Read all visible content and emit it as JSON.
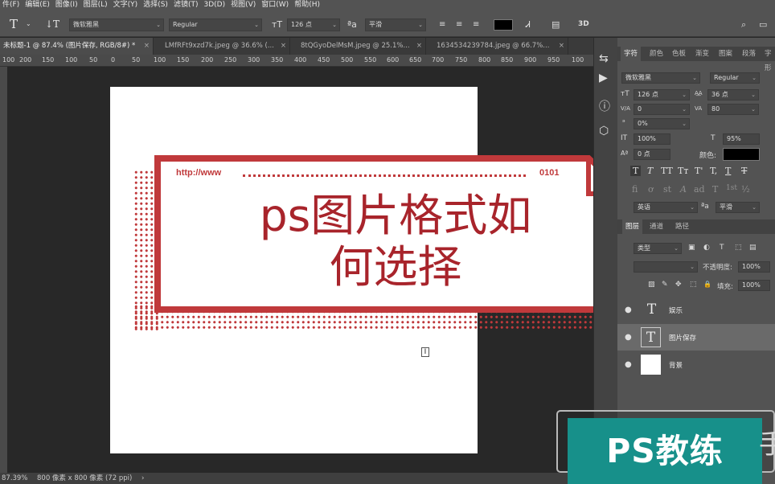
{
  "menu": [
    "件(F)",
    "编辑(E)",
    "图像(I)",
    "图层(L)",
    "文字(Y)",
    "选择(S)",
    "滤镜(T)",
    "3D(D)",
    "视图(V)",
    "窗口(W)",
    "帮助(H)"
  ],
  "options": {
    "tool_glyph": "T",
    "orient_glyph": "↓T",
    "font_family": "微软雅黑",
    "font_style": "Regular",
    "size_icon": "ᴛT",
    "font_size": "126 点",
    "aa_icon": "ªa",
    "antialias": "平滑",
    "warp_glyph": "Ꮧ",
    "panel_glyph": "▤",
    "threed_label": "3D",
    "text_color": "#000000",
    "search_glyph": "⌕",
    "workspace_glyph": "▭",
    "share_glyph": "⇪"
  },
  "tabs": [
    {
      "label": "未标题-1 @ 87.4% (图片保存, RGB/8#) *",
      "close": "×"
    },
    {
      "label": "LMfRFt9xzd7k.jpeg @ 36.6% (...",
      "close": "×"
    },
    {
      "label": "8tQGyoDelMsM.jpeg @ 25.1%...",
      "close": "×"
    },
    {
      "label": "1634534239784.jpeg @ 66.7%...",
      "close": "×"
    }
  ],
  "ruler_ticks": [
    "100",
    "200",
    "150",
    "100",
    "50",
    "0",
    "50",
    "100",
    "150",
    "200",
    "250",
    "300",
    "350",
    "400",
    "450",
    "500",
    "550",
    "600",
    "650",
    "700",
    "750",
    "800",
    "850",
    "900",
    "950",
    "100"
  ],
  "artwork": {
    "url_text": "http://www",
    "url_code": "0101",
    "headline_line1": "ps图片格式如",
    "headline_line2": "何选择",
    "accent": "#c0393b",
    "headline_color": "#a8242b",
    "cursor_glyph": "I"
  },
  "status": {
    "zoom": "87.39%",
    "doc_size": "800 像素 x 800 像素 (72 ppi)",
    "more": "›"
  },
  "strip_icons": [
    "⇆",
    "▶",
    "ⓘ",
    "⬡"
  ],
  "character_panel": {
    "tabs": [
      "字符",
      "颜色",
      "色板",
      "渐变",
      "图案",
      "段落",
      "字形"
    ],
    "font_family": "微软雅黑",
    "font_style": "Regular",
    "font_size": "126 点",
    "leading": "36 点",
    "kerning": "0",
    "tracking": "80",
    "tsume": "0%",
    "vscale": "100%",
    "hscale": "95%",
    "baseline": "0 点",
    "color_label": "颜色:",
    "language": "英语",
    "antialias": "平滑",
    "aa_icon": "ªa",
    "size_icon": "ᴛT",
    "leading_icon": "A͟A",
    "kern_icon": "V/A",
    "track_icon": "VA",
    "tsume_icon": "ᵊ",
    "vscale_icon": "IT",
    "hscale_icon": "T",
    "baseline_icon": "Aª",
    "style_buttons": [
      "T",
      "T",
      "TT",
      "Tт",
      "T'",
      "T,",
      "T",
      "T"
    ],
    "opentype_buttons": [
      "fi",
      "ơ",
      "st",
      "A",
      "ad",
      "T",
      "1st",
      "½"
    ]
  },
  "layers_panel": {
    "tabs": [
      "图层",
      "通道",
      "路径"
    ],
    "filter_label": "类型",
    "filter_icons": [
      "▣",
      "◐",
      "T",
      "⬚",
      "▤"
    ],
    "opacity_label": "不透明度:",
    "opacity": "100%",
    "fill_label": "填充:",
    "fill": "100%",
    "lock_icons": [
      "▨",
      "✎",
      "✥",
      "⬚",
      "🔒"
    ],
    "eye_glyph": "●",
    "layers": [
      {
        "name": "娱乐",
        "kind": "T"
      },
      {
        "name": "图片保存",
        "kind": "T"
      },
      {
        "name": "背景",
        "kind": ""
      }
    ]
  },
  "watermark": {
    "badge": "PS教练",
    "hand": "手"
  }
}
